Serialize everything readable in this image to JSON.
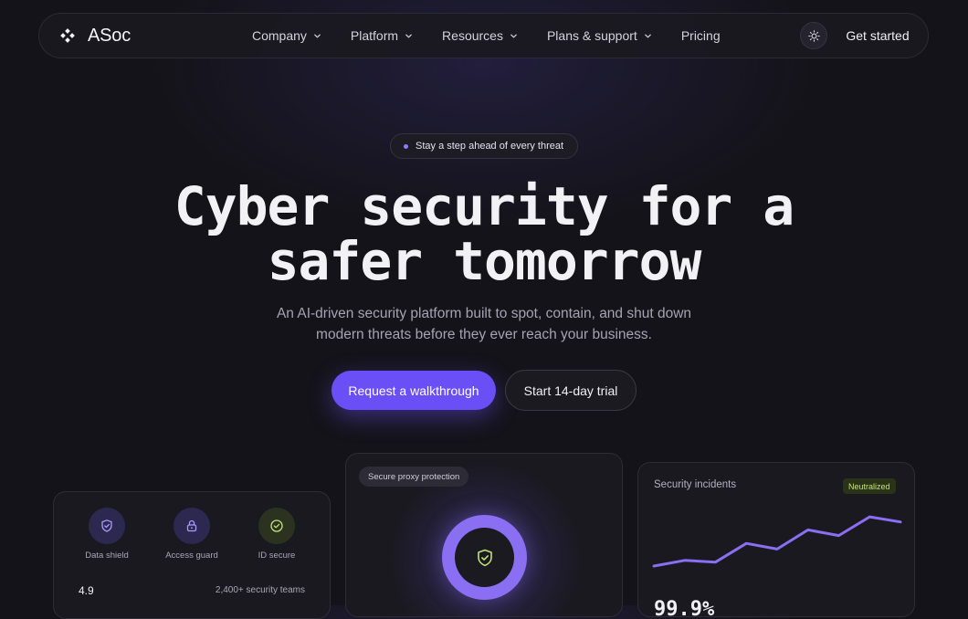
{
  "brand": {
    "name": "ASoc",
    "logo_icon": "four-diamond-logo-icon"
  },
  "nav": {
    "items": [
      {
        "label": "Company",
        "has_dropdown": true
      },
      {
        "label": "Platform",
        "has_dropdown": true
      },
      {
        "label": "Resources",
        "has_dropdown": true
      },
      {
        "label": "Plans & support",
        "has_dropdown": true
      },
      {
        "label": "Pricing",
        "has_dropdown": false
      }
    ],
    "theme_toggle_icon": "sun-icon",
    "cta_label": "Get started"
  },
  "hero": {
    "badge": "Stay a step ahead of every threat",
    "headline_line1": "Cyber security for a",
    "headline_line2": "safer tomorrow",
    "subtext": "An AI-driven security platform built to spot, contain, and shut down modern threats before they ever reach your business.",
    "primary_cta": "Request a walkthrough",
    "secondary_cta": "Start 14-day trial"
  },
  "cards": {
    "features": {
      "items": [
        {
          "label": "Data shield",
          "icon": "shield-icon"
        },
        {
          "label": "Access guard",
          "icon": "lock-icon"
        },
        {
          "label": "ID secure",
          "icon": "check-circle-icon"
        }
      ],
      "rating": "4.9",
      "teams": "2,400+ security teams"
    },
    "proxy": {
      "label": "Secure proxy protection",
      "icon": "shield-check-icon"
    },
    "incidents": {
      "title": "Security incidents",
      "status": "Neutralized",
      "stat": "99.9%",
      "trend": [
        0.08,
        0.18,
        0.15,
        0.48,
        0.38,
        0.72,
        0.62,
        0.95,
        0.86
      ]
    }
  },
  "colors": {
    "background": "#141319",
    "accent": "#6a4ff6",
    "accent_light": "#8a6ff2",
    "success": "#c4e37a",
    "text": "#f2f1f6",
    "muted": "#a6a3b2"
  }
}
